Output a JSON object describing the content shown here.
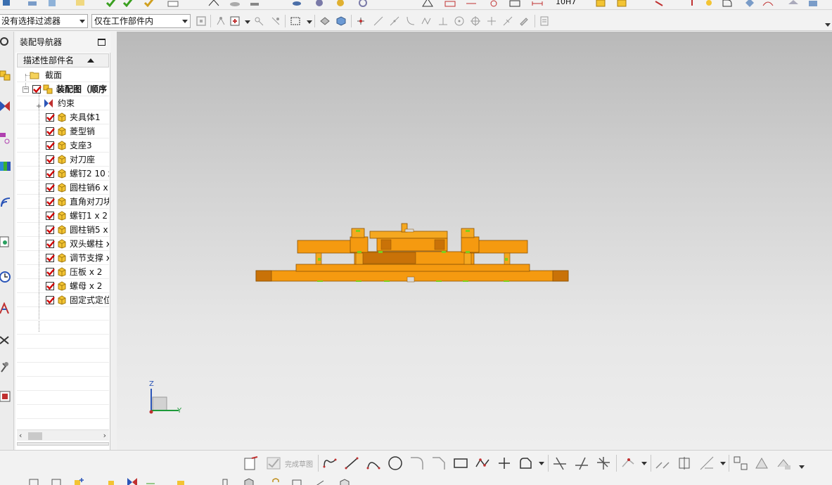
{
  "toolbar_top": {
    "dimension_label": "10H7"
  },
  "filter_bar": {
    "type_filter": "没有选择过滤器",
    "scope_filter": "仅在工作部件内"
  },
  "navigator": {
    "title": "装配导航器",
    "column_header": "描述性部件名",
    "tree": [
      {
        "label": "截面",
        "kind": "folder",
        "level": 1
      },
      {
        "label": "装配图（顺序",
        "kind": "assembly",
        "level": 0,
        "checked": true,
        "bold": true
      },
      {
        "label": "约束",
        "kind": "constraints",
        "level": 1
      },
      {
        "label": "夹具体1",
        "kind": "part",
        "level": 2,
        "checked": true
      },
      {
        "label": "菱型销",
        "kind": "part",
        "level": 2,
        "checked": true
      },
      {
        "label": "支座3",
        "kind": "part",
        "level": 2,
        "checked": true
      },
      {
        "label": "对刀座",
        "kind": "part",
        "level": 2,
        "checked": true
      },
      {
        "label": "螺钉2 10 x",
        "kind": "part",
        "level": 2,
        "checked": true
      },
      {
        "label": "圆柱销6 x",
        "kind": "part",
        "level": 2,
        "checked": true
      },
      {
        "label": "直角对刀块",
        "kind": "part",
        "level": 2,
        "checked": true
      },
      {
        "label": "螺钉1 x 2",
        "kind": "part",
        "level": 2,
        "checked": true
      },
      {
        "label": "圆柱销5 x",
        "kind": "part",
        "level": 2,
        "checked": true
      },
      {
        "label": "双头螺柱 x",
        "kind": "part",
        "level": 2,
        "checked": true
      },
      {
        "label": "调节支撑 x",
        "kind": "part",
        "level": 2,
        "checked": true
      },
      {
        "label": "压板 x 2",
        "kind": "part",
        "level": 2,
        "checked": true
      },
      {
        "label": "螺母 x 2",
        "kind": "part",
        "level": 2,
        "checked": true
      },
      {
        "label": "固定式定位",
        "kind": "part",
        "level": 2,
        "checked": true
      }
    ]
  },
  "viewport": {
    "axes": {
      "z": "Z",
      "y": "Y"
    },
    "colors": {
      "part": "#f59a10",
      "part_dark": "#c97208",
      "pin": "#7ccf1c"
    }
  },
  "sketch_toolbar": {
    "finish_sketch_label": "完成草图"
  },
  "icons": [
    "folder-icon",
    "assembly-icon",
    "constraint-icon",
    "part-cube-icon",
    "checkbox-icon",
    "maximize-icon",
    "sort-ascending-icon"
  ]
}
